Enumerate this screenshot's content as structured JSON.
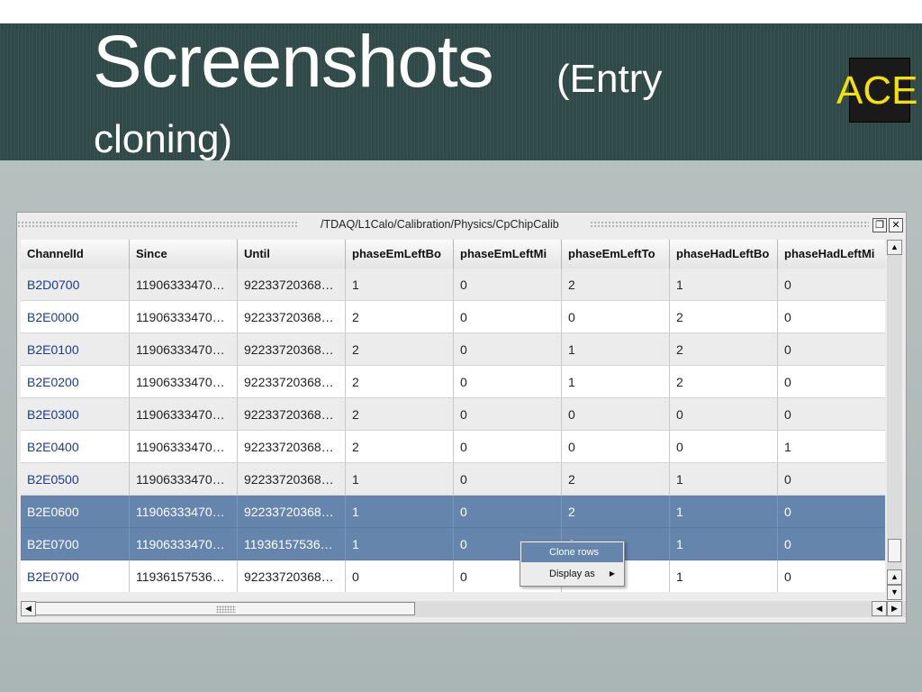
{
  "slide": {
    "title_main": "Screenshots",
    "title_paren": "(Entry",
    "title_line2": "cloning)",
    "logo": "ACE"
  },
  "window": {
    "path": "/TDAQ/L1Calo/Calibration/Physics/CpChipCalib",
    "buttons": [
      "restore-icon",
      "close-icon"
    ]
  },
  "table": {
    "columns": [
      "ChannelId",
      "Since",
      "Until",
      "phaseEmLeftBo",
      "phaseEmLeftMi",
      "phaseEmLeftTo",
      "phaseHadLeftBo",
      "phaseHadLeftMi"
    ],
    "rows": [
      {
        "cells": [
          "B2D0700",
          "11906333470…",
          "92233720368…",
          "1",
          "0",
          "2",
          "1",
          "0"
        ],
        "selected": false
      },
      {
        "cells": [
          "B2E0000",
          "11906333470…",
          "92233720368…",
          "2",
          "0",
          "0",
          "2",
          "0"
        ],
        "selected": false
      },
      {
        "cells": [
          "B2E0100",
          "11906333470…",
          "92233720368…",
          "2",
          "0",
          "1",
          "2",
          "0"
        ],
        "selected": false
      },
      {
        "cells": [
          "B2E0200",
          "11906333470…",
          "92233720368…",
          "2",
          "0",
          "1",
          "2",
          "0"
        ],
        "selected": false
      },
      {
        "cells": [
          "B2E0300",
          "11906333470…",
          "92233720368…",
          "2",
          "0",
          "0",
          "0",
          "0"
        ],
        "selected": false
      },
      {
        "cells": [
          "B2E0400",
          "11906333470…",
          "92233720368…",
          "2",
          "0",
          "0",
          "0",
          "1"
        ],
        "selected": false
      },
      {
        "cells": [
          "B2E0500",
          "11906333470…",
          "92233720368…",
          "1",
          "0",
          "2",
          "1",
          "0"
        ],
        "selected": false
      },
      {
        "cells": [
          "B2E0600",
          "11906333470…",
          "92233720368…",
          "1",
          "0",
          "2",
          "1",
          "0"
        ],
        "selected": true
      },
      {
        "cells": [
          "B2E0700",
          "11906333470…",
          "11936157536…",
          "1",
          "0",
          "2",
          "1",
          "0"
        ],
        "selected": true
      },
      {
        "cells": [
          "B2E0700",
          "11936157536…",
          "92233720368…",
          "0",
          "0",
          "",
          "1",
          "0"
        ],
        "selected": false
      }
    ]
  },
  "context_menu": {
    "items": [
      {
        "label": "Clone rows",
        "highlighted": true,
        "submenu": false
      },
      {
        "label": "Display as",
        "highlighted": false,
        "submenu": true
      }
    ]
  },
  "colors": {
    "band": "#2f4a48",
    "selection": "#6585ad",
    "logo_text": "#f3e200",
    "id_text": "#1a3c8c"
  }
}
